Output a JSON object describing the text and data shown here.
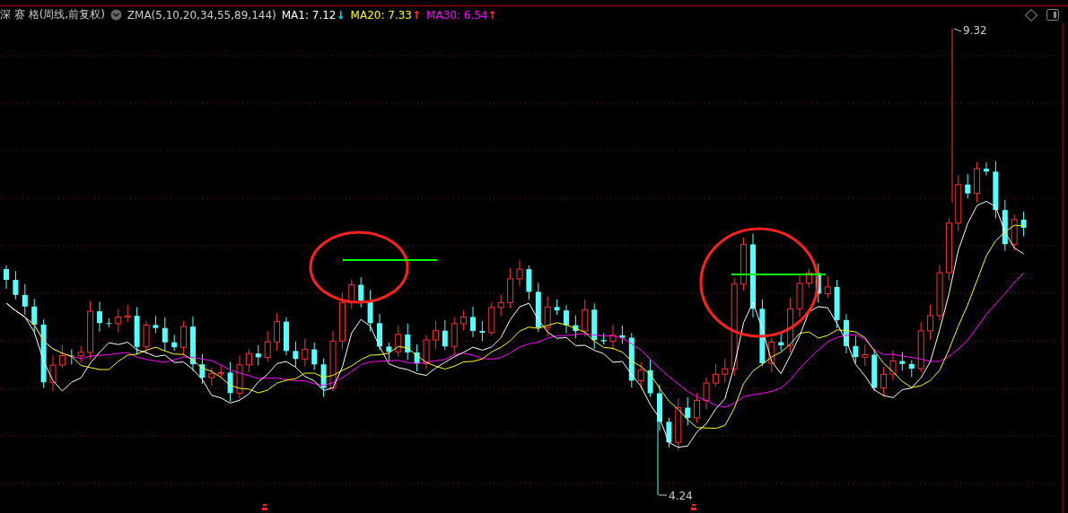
{
  "legend": {
    "title": "深 赛 格(周线,前复权)",
    "indicator": "ZMA(5,10,20,34,55,89,144)",
    "averages": [
      {
        "label": "MA1: 7.12",
        "arrow": "↓",
        "color": "#ffffff",
        "rising": false
      },
      {
        "label": "MA20: 7.33",
        "arrow": "↑",
        "color": "#ffff00",
        "rising": true
      },
      {
        "label": "MA30: 6.54",
        "arrow": "↑",
        "color": "#ff00ff",
        "rising": true
      }
    ]
  },
  "chart": {
    "high_label": "9.32",
    "low_label": "4.24"
  }
}
